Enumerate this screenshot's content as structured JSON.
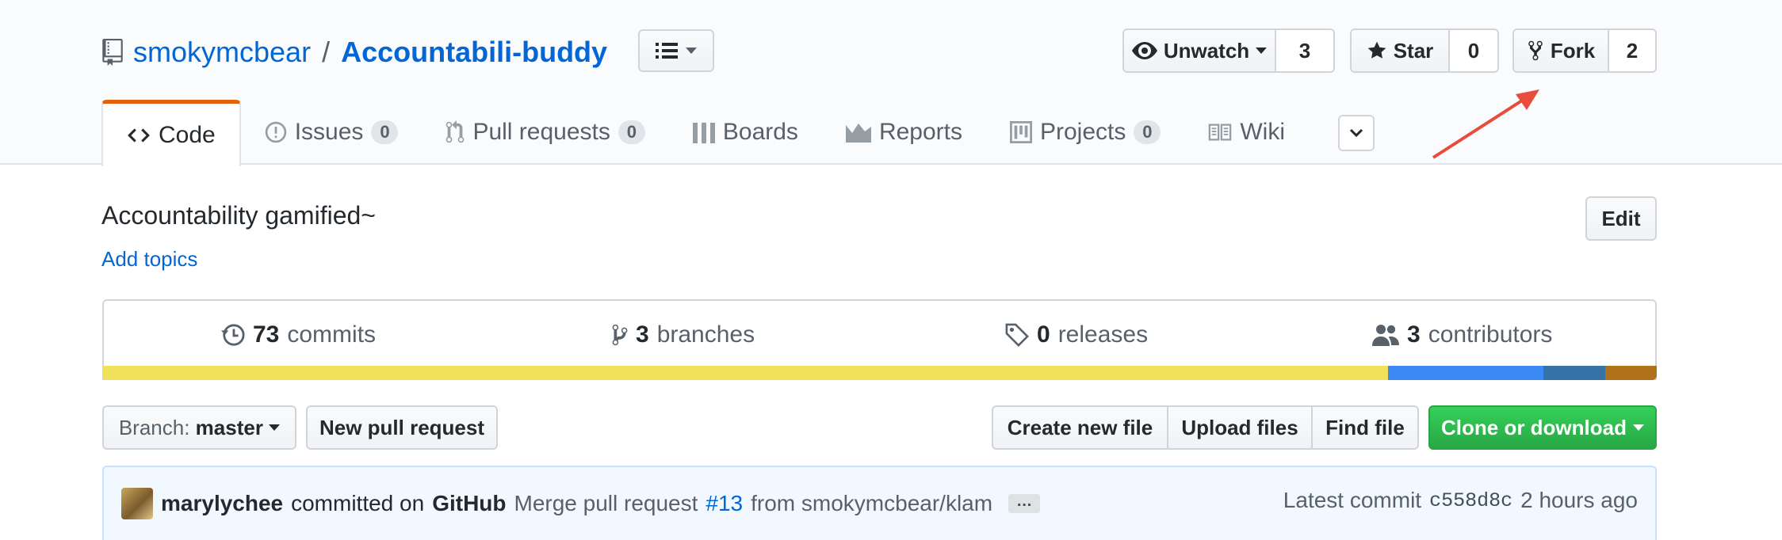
{
  "repo": {
    "owner": "smokymcbear",
    "separator": "/",
    "name": "Accountabili-buddy",
    "description": "Accountability gamified~",
    "add_topics": "Add topics"
  },
  "actions": {
    "watch": {
      "label": "Unwatch",
      "count": "3"
    },
    "star": {
      "label": "Star",
      "count": "0"
    },
    "fork": {
      "label": "Fork",
      "count": "2"
    }
  },
  "tabs": [
    {
      "label": "Code",
      "icon": "code-icon"
    },
    {
      "label": "Issues",
      "count": "0",
      "icon": "issue-icon"
    },
    {
      "label": "Pull requests",
      "count": "0",
      "icon": "git-pull-request-icon"
    },
    {
      "label": "Boards",
      "icon": "boards-icon"
    },
    {
      "label": "Reports",
      "icon": "graph-icon"
    },
    {
      "label": "Projects",
      "count": "0",
      "icon": "project-icon"
    },
    {
      "label": "Wiki",
      "icon": "book-icon"
    }
  ],
  "edit_label": "Edit",
  "summary": {
    "commits": {
      "count": "73",
      "label": "commits"
    },
    "branches": {
      "count": "3",
      "label": "branches"
    },
    "releases": {
      "count": "0",
      "label": "releases"
    },
    "contributors": {
      "count": "3",
      "label": "contributors"
    }
  },
  "language_bar": [
    {
      "color": "#f1e05a",
      "percent": 82.7
    },
    {
      "color": "#3b89f5",
      "percent": 10.0
    },
    {
      "color": "#3572a5",
      "percent": 4.0
    },
    {
      "color": "#b07219",
      "percent": 3.3
    }
  ],
  "file_nav": {
    "branch_prefix": "Branch:",
    "branch_name": "master",
    "new_pr": "New pull request",
    "create_file": "Create new file",
    "upload_files": "Upload files",
    "find_file": "Find file",
    "clone": "Clone or download"
  },
  "commit": {
    "author": "marylychee",
    "committed_on": "committed on",
    "platform": "GitHub",
    "message_prefix": "Merge pull request",
    "pr_number": "#13",
    "message_suffix": "from smokymcbear/klam",
    "ellipsis": "…",
    "latest_label": "Latest commit",
    "sha": "c558d8c",
    "time": "2 hours ago"
  },
  "colors": {
    "accent_link": "#0366d6",
    "selected_tab_border": "#e36209",
    "clone_green": "#28a745",
    "annotation_arrow": "#e74c3c"
  }
}
